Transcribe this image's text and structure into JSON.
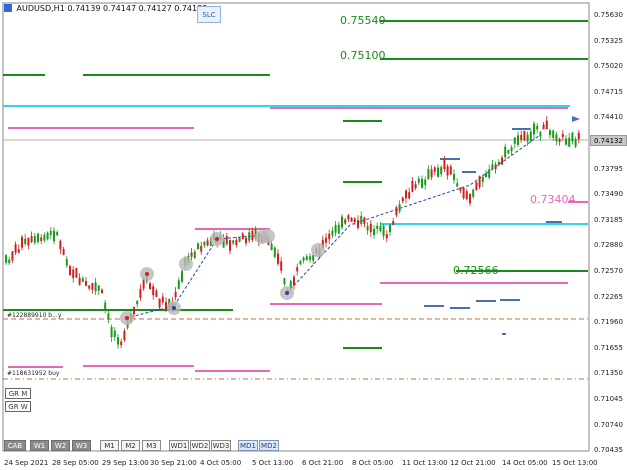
{
  "header": {
    "symbol": "AUDUSD,H1",
    "ohlc": "0.74139 0.74147 0.74127 0.74132",
    "slc_label": "SLC"
  },
  "price_axis": {
    "labels": [
      "0.75630",
      "0.75325",
      "0.75020",
      "0.74715",
      "0.74410",
      "0.74105",
      "0.73795",
      "0.73490",
      "0.73185",
      "0.72880",
      "0.72570",
      "0.72265",
      "0.71960",
      "0.71655",
      "0.71350",
      "0.71045",
      "0.70740",
      "0.70435"
    ],
    "current_price": "0.74132"
  },
  "time_axis": {
    "labels": [
      "24 Sep 2021",
      "28 Sep 05:00",
      "29 Sep 13:00",
      "30 Sep 21:00",
      "4 Oct 05:00",
      "5 Oct 13:00",
      "6 Oct 21:00",
      "8 Oct 05:00",
      "11 Oct 13:00",
      "12 Oct 21:00",
      "14 Oct 05:00",
      "15 Oct 13:00"
    ]
  },
  "price_labels": {
    "level_75540": "0.75540",
    "level_75100": "0.75100",
    "level_73404": "0.73404",
    "level_72566": "0.72566"
  },
  "trade_labels": {
    "buy_upper": "#122889910 b...y",
    "buy_lower": "#118631952 buy"
  },
  "gr_buttons": [
    "GR M",
    "GR W"
  ],
  "timeframe_buttons": {
    "cab": "CAB",
    "w": [
      "W1",
      "W2",
      "W3"
    ],
    "m": [
      "M1",
      "M2",
      "M3"
    ],
    "wd": [
      "WD1",
      "WD2",
      "WD3"
    ],
    "md": [
      "MD1",
      "MD2"
    ]
  },
  "colors": {
    "green_level": "#1a8a1a",
    "pink_level": "#e868b8",
    "cyan_level": "#30d6e6",
    "candle_bull": "#1a9a1a",
    "candle_bear": "#d02020",
    "trend_line": "#2244aa",
    "orange_dash": "#c07030",
    "blue_marks": "#4a6fb0"
  }
}
